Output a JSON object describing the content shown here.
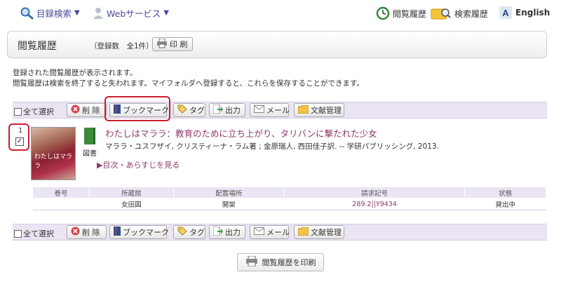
{
  "topnav": {
    "catalog_search": "目録検索",
    "web_services": "Webサービス",
    "history": "閲覧履歴",
    "search_history": "検索履歴",
    "language": "English"
  },
  "panel": {
    "title": "閲覧履歴",
    "count": "（登録数　全1件）",
    "print": "印 刷"
  },
  "description": [
    "登録された閲覧履歴が表示されます。",
    "閲覧履歴は検索を終了すると失われます。マイフォルダへ登録すると、これらを保存することができます。"
  ],
  "actions": {
    "select_all": "全て選択",
    "delete": "削 除",
    "bookmark": "ブックマーク",
    "tag": "タグ",
    "export": "出力",
    "mail": "メール",
    "bibliography": "文献管理"
  },
  "record": {
    "number": "1",
    "checked": "✓",
    "type": "図書",
    "cover_text": "わたしはマララ",
    "title": "わたしはマララ：教育のために立ち上がり、タリバンに撃たれた少女",
    "meta": "マララ・ユスフザイ, クリスティーナ・ラム著 ; 金原瑞人, 西田佳子訳. -- 学研パブリッシング, 2013.",
    "link": "▶目次・あらすじを見る"
  },
  "holdings": {
    "headers": [
      "巻号",
      "所蔵館",
      "配置場所",
      "請求記号",
      "状態"
    ],
    "row": [
      "",
      "女田図",
      "開架",
      "289.2||Y9434",
      "貸出中"
    ]
  },
  "footer": {
    "print_history": "閲覧履歴を印刷"
  },
  "colors": {
    "accent": "#8e3a6a",
    "bar": "#ebe4f3",
    "highlight": "#c8202f"
  }
}
